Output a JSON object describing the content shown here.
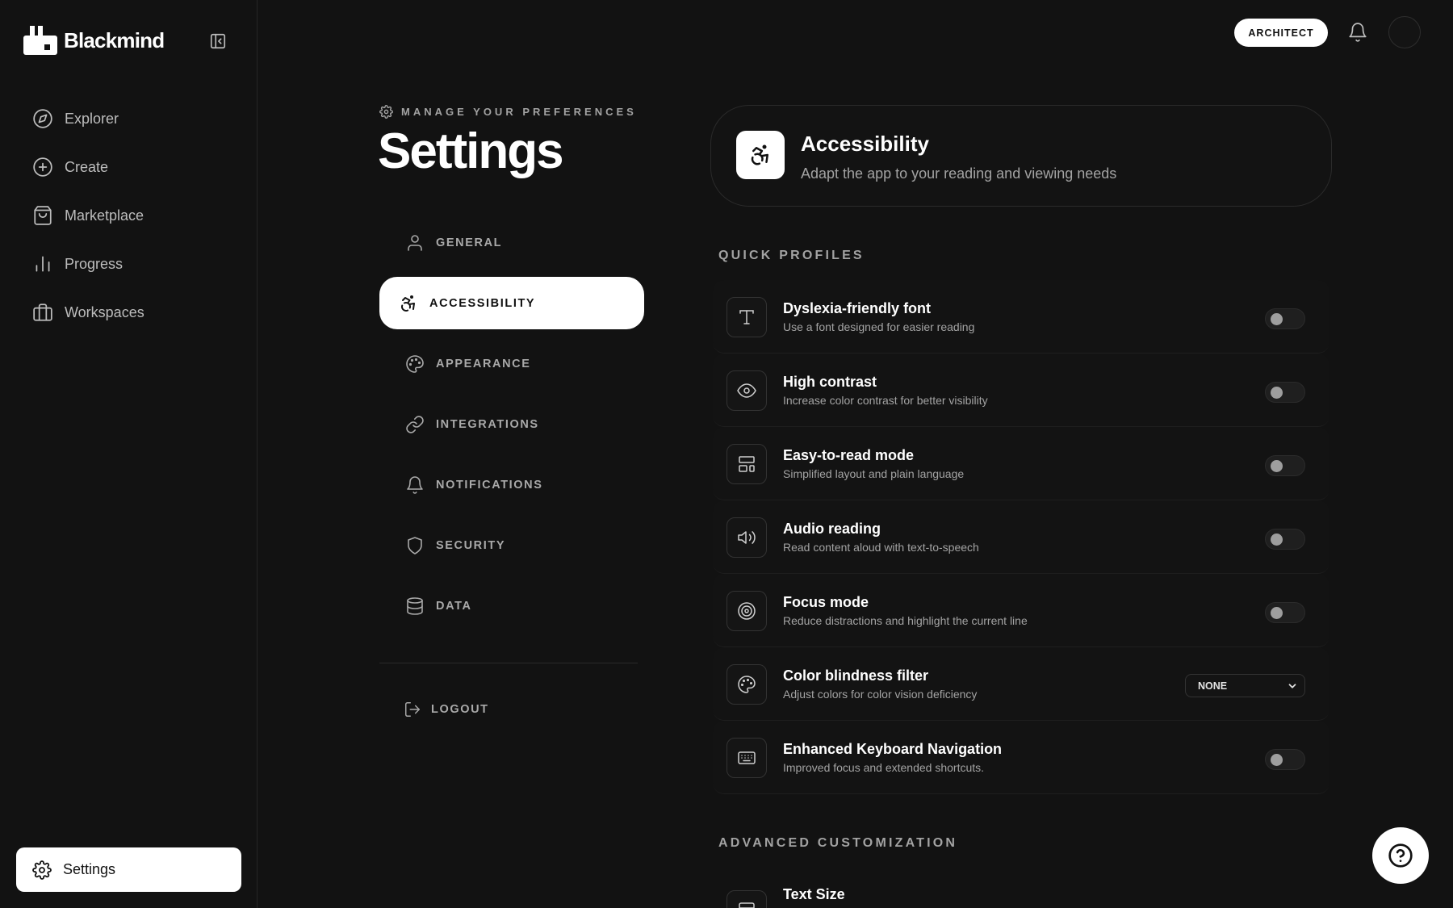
{
  "app": {
    "name": "Blackmind"
  },
  "sidebar": {
    "items": [
      {
        "label": "Explorer",
        "icon": "compass-icon"
      },
      {
        "label": "Create",
        "icon": "plus-circle-icon"
      },
      {
        "label": "Marketplace",
        "icon": "shopping-bag-icon"
      },
      {
        "label": "Progress",
        "icon": "bar-chart-icon"
      },
      {
        "label": "Workspaces",
        "icon": "briefcase-icon"
      }
    ],
    "settings_label": "Settings"
  },
  "topbar": {
    "role": "ARCHITECT"
  },
  "header": {
    "eyebrow": "MANAGE YOUR PREFERENCES",
    "title": "Settings"
  },
  "menu": {
    "items": [
      {
        "label": "GENERAL",
        "icon": "user-icon"
      },
      {
        "label": "ACCESSIBILITY",
        "icon": "accessibility-icon",
        "active": true
      },
      {
        "label": "APPEARANCE",
        "icon": "palette-icon"
      },
      {
        "label": "INTEGRATIONS",
        "icon": "link-icon"
      },
      {
        "label": "NOTIFICATIONS",
        "icon": "bell-icon"
      },
      {
        "label": "SECURITY",
        "icon": "shield-icon"
      },
      {
        "label": "DATA",
        "icon": "database-icon"
      }
    ],
    "logout": "LOGOUT"
  },
  "main": {
    "card": {
      "title": "Accessibility",
      "description": "Adapt the app to your reading and viewing needs"
    },
    "quick_profiles_title": "QUICK PROFILES",
    "profiles": [
      {
        "title": "Dyslexia-friendly font",
        "description": "Use a font designed for easier reading",
        "icon": "type-icon",
        "control": "toggle",
        "enabled": false
      },
      {
        "title": "High contrast",
        "description": "Increase color contrast for better visibility",
        "icon": "eye-icon",
        "control": "toggle",
        "enabled": false
      },
      {
        "title": "Easy-to-read mode",
        "description": "Simplified layout and plain language",
        "icon": "layout-icon",
        "control": "toggle",
        "enabled": false
      },
      {
        "title": "Audio reading",
        "description": "Read content aloud with text-to-speech",
        "icon": "speaker-icon",
        "control": "toggle",
        "enabled": false
      },
      {
        "title": "Focus mode",
        "description": "Reduce distractions and highlight the current line",
        "icon": "target-icon",
        "control": "toggle",
        "enabled": false
      },
      {
        "title": "Color blindness filter",
        "description": "Adjust colors for color vision deficiency",
        "icon": "palette-icon",
        "control": "select",
        "value": "NONE"
      },
      {
        "title": "Enhanced Keyboard Navigation",
        "description": "Improved focus and extended shortcuts.",
        "icon": "keyboard-icon",
        "control": "toggle",
        "enabled": false
      }
    ],
    "advanced_title": "ADVANCED CUSTOMIZATION",
    "advanced_first": {
      "title": "Text Size",
      "icon": "text-size-icon"
    }
  },
  "colors": {
    "background": "#121212",
    "surface": "#131313",
    "accent": "#ffffff",
    "muted_text": "#a3a3a3"
  }
}
